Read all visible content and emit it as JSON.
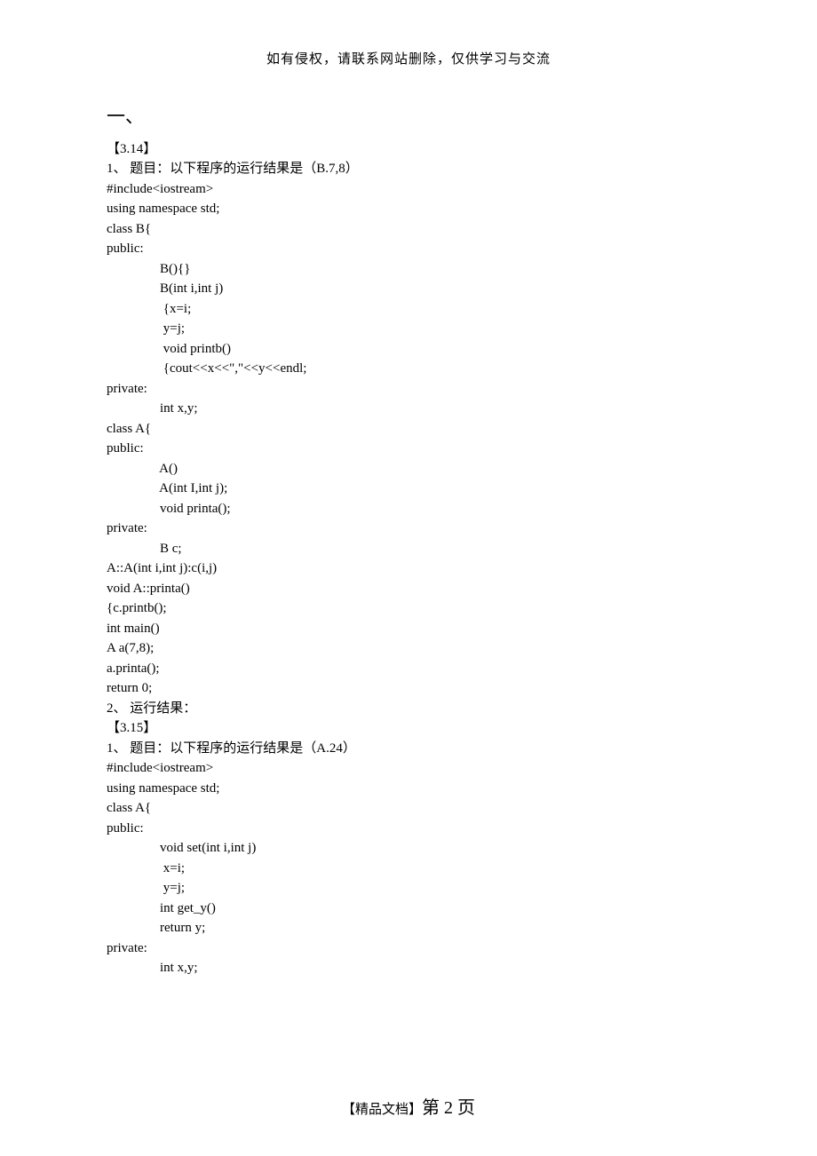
{
  "header": {
    "notice": "如有侵权，请联系网站删除，仅供学习与交流"
  },
  "doc": {
    "section_heading": "一、",
    "q1": {
      "tag": "【3.14】",
      "prompt": "1、 题目：以下程序的运行结果是（B.7,8）",
      "code": [
        "#include<iostream>",
        "using namespace std;",
        "class B{",
        "public:",
        "    B(){}",
        "    B(int i,int j)",
        "     {x=i;",
        "     y=j;",
        "     void printb()",
        "     {cout<<x<<\",\"<<y<<endl;",
        "private:",
        "    int x,y;",
        "class A{",
        "public:",
        "    A()",
        "    A(int I,int j);",
        "    void printa();",
        "private:",
        "    B c;",
        "A::A(int i,int j):c(i,j)",
        "void A::printa()",
        "{c.printb();",
        "int main()",
        "A a(7,8);",
        "a.printa();",
        "return 0;"
      ],
      "result_label": "2、 运行结果："
    },
    "q2": {
      "tag": "【3.15】",
      "prompt": "1、 题目：以下程序的运行结果是（A.24）",
      "code": [
        "#include<iostream>",
        "using namespace std;",
        "class A{",
        "public:",
        "    void set(int i,int j)",
        "     x=i;",
        "     y=j;",
        "    int get_y()",
        "    return y;",
        "private:",
        "    int x,y;"
      ]
    }
  },
  "footer": {
    "doc_label": "【精品文档】",
    "page_prefix": "第 ",
    "page_num": "2",
    "page_suffix": " 页"
  }
}
